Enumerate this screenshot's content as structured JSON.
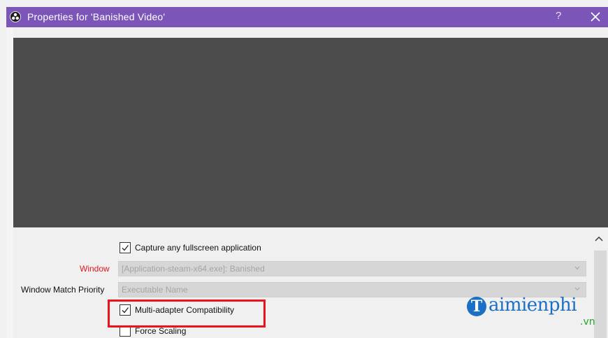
{
  "window": {
    "title": "Properties for 'Banished Video'",
    "help_label": "?",
    "title_bar_color": "#7b55b8"
  },
  "preview": {
    "background": "#4c4c4c"
  },
  "form": {
    "capture_fullscreen": {
      "label": "Capture any fullscreen application",
      "checked": true
    },
    "window_field": {
      "label": "Window",
      "value": "[Application-steam-x64.exe]: Banished",
      "label_color": "#e0181e"
    },
    "match_priority": {
      "label": "Window Match Priority",
      "value": "Executable Name"
    },
    "multi_adapter": {
      "label": "Multi-adapter Compatibility",
      "checked": true
    },
    "force_scaling": {
      "label": "Force Scaling",
      "checked": false
    }
  },
  "highlight_color": "#e8141e",
  "watermark": {
    "letter": "T",
    "word": "aimienphi",
    "suffix": ".vn"
  }
}
